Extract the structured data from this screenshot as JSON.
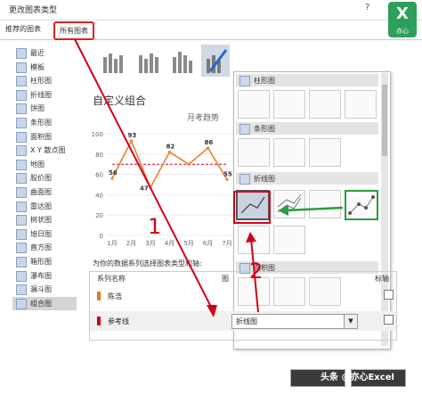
{
  "window": {
    "title": "更改图表类型",
    "help_icon": "?"
  },
  "logo": {
    "text": "X",
    "subtitle": "亦心"
  },
  "tabs": [
    {
      "label": "推荐的图表"
    },
    {
      "label": "所有图表"
    }
  ],
  "chart_types": [
    {
      "label": "最近"
    },
    {
      "label": "模板"
    },
    {
      "label": "柱形图"
    },
    {
      "label": "折线图"
    },
    {
      "label": "饼图"
    },
    {
      "label": "条形图"
    },
    {
      "label": "面积图"
    },
    {
      "label": "X Y 散点图"
    },
    {
      "label": "地图"
    },
    {
      "label": "股价图"
    },
    {
      "label": "曲面图"
    },
    {
      "label": "雷达图"
    },
    {
      "label": "树状图"
    },
    {
      "label": "旭日图"
    },
    {
      "label": "直方图"
    },
    {
      "label": "箱形图"
    },
    {
      "label": "瀑布图"
    },
    {
      "label": "漏斗图"
    },
    {
      "label": "组合图"
    }
  ],
  "preview": {
    "heading": "自定义组合",
    "chart_title": "月考趋势"
  },
  "gallery": {
    "sections": [
      {
        "label": "柱形图"
      },
      {
        "label": "条形图"
      },
      {
        "label": "折线图"
      },
      {
        "label": "面积图"
      }
    ]
  },
  "series_panel": {
    "instruction": "为你的数据系列选择图表类型和轴:",
    "col_name": "系列名称",
    "col_type": "图",
    "col_axis": "标轴",
    "rows": [
      {
        "name": "陈浩",
        "color": "#e07b2a"
      },
      {
        "name": "参考线",
        "color": "#d0021b",
        "chart_type": "折线图"
      }
    ]
  },
  "annotations": {
    "step1": "1",
    "step2": "2"
  },
  "watermark": "头条 @亦心Excel",
  "chart_data": {
    "type": "line",
    "categories": [
      "1月",
      "2月",
      "3月",
      "4月",
      "5月",
      "6月",
      "7月"
    ],
    "series": [
      {
        "name": "陈浩",
        "values": [
          56,
          93,
          47,
          82,
          70,
          86,
          55
        ]
      },
      {
        "name": "参考线",
        "values": [
          70,
          70,
          70,
          70,
          70,
          70,
          70
        ]
      }
    ],
    "ylim": [
      0,
      100
    ],
    "yticks": [
      0,
      20,
      40,
      60,
      80,
      100
    ],
    "data_labels": [
      "56",
      "93",
      "47",
      "82",
      "86",
      "55"
    ],
    "colors": {
      "main": "#e8822f",
      "ref": "#d0021b"
    }
  }
}
